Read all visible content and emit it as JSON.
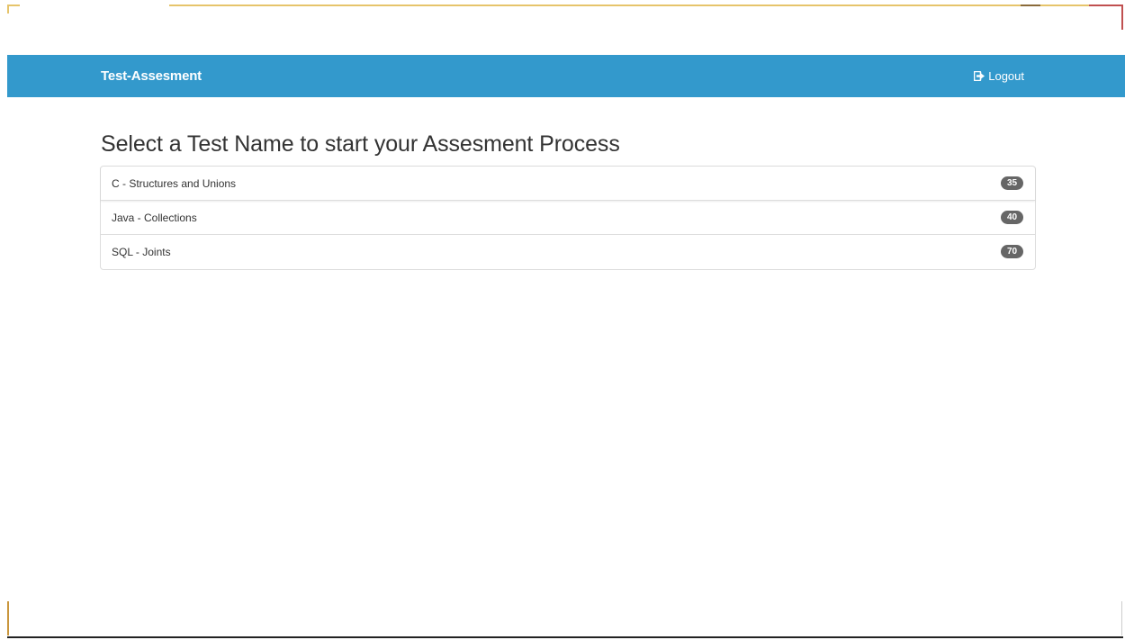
{
  "navbar": {
    "brand": "Test-Assesment",
    "logout_label": "Logout",
    "logout_icon": "log-out-icon",
    "background_color": "#3399cc"
  },
  "main": {
    "heading": "Select a Test Name to start your Assesment Process",
    "tests": [
      {
        "name": "C - Structures and Unions",
        "count": "35"
      },
      {
        "name": "Java - Collections",
        "count": "40"
      },
      {
        "name": "SQL - Joints",
        "count": "70"
      }
    ]
  }
}
